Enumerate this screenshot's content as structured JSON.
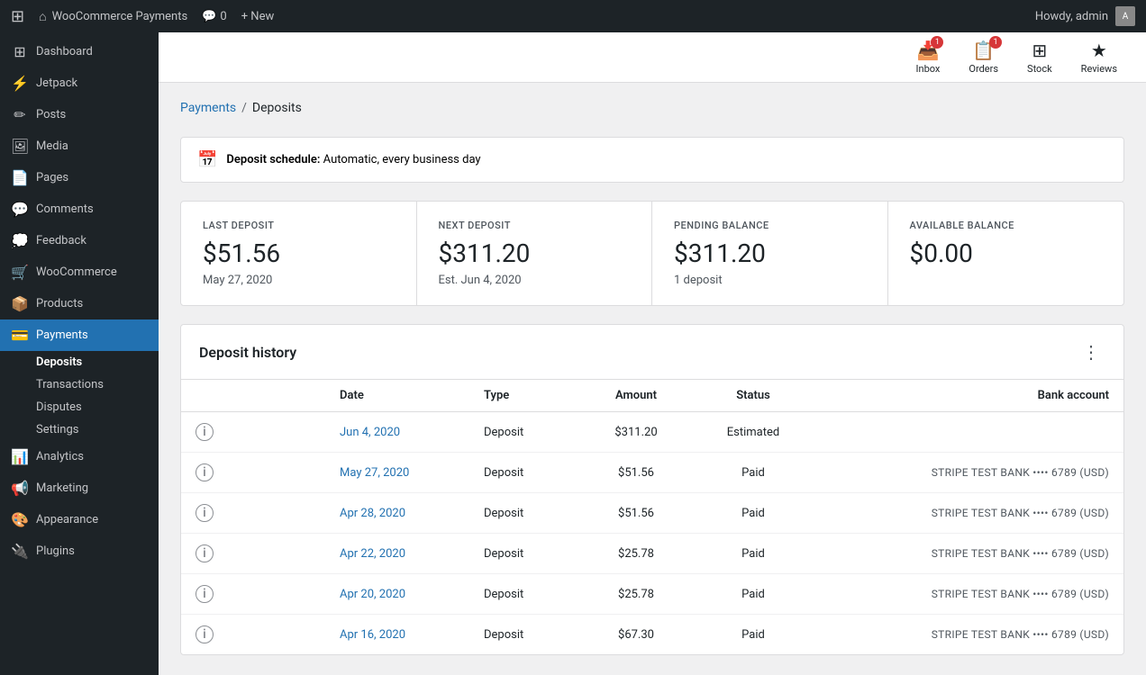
{
  "adminBar": {
    "wpLogo": "⊞",
    "siteName": "WooCommerce Payments",
    "commentsIcon": "💬",
    "commentsCount": "0",
    "newLabel": "+ New",
    "howdy": "Howdy, admin"
  },
  "sidebar": {
    "items": [
      {
        "id": "dashboard",
        "label": "Dashboard",
        "icon": "⊞"
      },
      {
        "id": "jetpack",
        "label": "Jetpack",
        "icon": "⚡"
      },
      {
        "id": "posts",
        "label": "Posts",
        "icon": "✏"
      },
      {
        "id": "media",
        "label": "Media",
        "icon": "🖼"
      },
      {
        "id": "pages",
        "label": "Pages",
        "icon": "📄"
      },
      {
        "id": "comments",
        "label": "Comments",
        "icon": "💬"
      },
      {
        "id": "feedback",
        "label": "Feedback",
        "icon": "💭"
      },
      {
        "id": "woocommerce",
        "label": "WooCommerce",
        "icon": "🛒"
      },
      {
        "id": "products",
        "label": "Products",
        "icon": "📦"
      },
      {
        "id": "payments",
        "label": "Payments",
        "icon": "💳"
      }
    ],
    "paymentsSubItems": [
      {
        "id": "deposits",
        "label": "Deposits",
        "active": true
      },
      {
        "id": "transactions",
        "label": "Transactions"
      },
      {
        "id": "disputes",
        "label": "Disputes"
      },
      {
        "id": "settings",
        "label": "Settings"
      }
    ],
    "bottomItems": [
      {
        "id": "analytics",
        "label": "Analytics",
        "icon": "📊"
      },
      {
        "id": "marketing",
        "label": "Marketing",
        "icon": "📢"
      },
      {
        "id": "appearance",
        "label": "Appearance",
        "icon": "🎨"
      },
      {
        "id": "plugins",
        "label": "Plugins",
        "icon": "🔌"
      }
    ]
  },
  "toolbar": {
    "buttons": [
      {
        "id": "inbox",
        "label": "Inbox",
        "icon": "📥",
        "badge": "1"
      },
      {
        "id": "orders",
        "label": "Orders",
        "icon": "📋",
        "badge": "1"
      },
      {
        "id": "stock",
        "label": "Stock",
        "icon": "⊞",
        "badge": null
      },
      {
        "id": "reviews",
        "label": "Reviews",
        "icon": "★",
        "badge": null
      }
    ]
  },
  "breadcrumb": {
    "parentLabel": "Payments",
    "separator": "/",
    "currentLabel": "Deposits"
  },
  "depositSchedule": {
    "label": "Deposit schedule:",
    "value": "Automatic, every business day"
  },
  "stats": [
    {
      "id": "last-deposit",
      "label": "LAST DEPOSIT",
      "value": "$51.56",
      "sub": "May 27, 2020"
    },
    {
      "id": "next-deposit",
      "label": "NEXT DEPOSIT",
      "value": "$311.20",
      "sub": "Est. Jun 4, 2020"
    },
    {
      "id": "pending-balance",
      "label": "PENDING BALANCE",
      "value": "$311.20",
      "sub": "1 deposit"
    },
    {
      "id": "available-balance",
      "label": "AVAILABLE BALANCE",
      "value": "$0.00",
      "sub": ""
    }
  ],
  "depositHistory": {
    "title": "Deposit history",
    "columns": {
      "date": "Date",
      "type": "Type",
      "amount": "Amount",
      "status": "Status",
      "bank": "Bank account"
    },
    "rows": [
      {
        "date": "Jun 4, 2020",
        "type": "Deposit",
        "amount": "$311.20",
        "status": "Estimated",
        "bank": ""
      },
      {
        "date": "May 27, 2020",
        "type": "Deposit",
        "amount": "$51.56",
        "status": "Paid",
        "bank": "STRIPE TEST BANK •••• 6789 (USD)"
      },
      {
        "date": "Apr 28, 2020",
        "type": "Deposit",
        "amount": "$51.56",
        "status": "Paid",
        "bank": "STRIPE TEST BANK •••• 6789 (USD)"
      },
      {
        "date": "Apr 22, 2020",
        "type": "Deposit",
        "amount": "$25.78",
        "status": "Paid",
        "bank": "STRIPE TEST BANK •••• 6789 (USD)"
      },
      {
        "date": "Apr 20, 2020",
        "type": "Deposit",
        "amount": "$25.78",
        "status": "Paid",
        "bank": "STRIPE TEST BANK •••• 6789 (USD)"
      },
      {
        "date": "Apr 16, 2020",
        "type": "Deposit",
        "amount": "$67.30",
        "status": "Paid",
        "bank": "STRIPE TEST BANK •••• 6789 (USD)"
      }
    ]
  }
}
